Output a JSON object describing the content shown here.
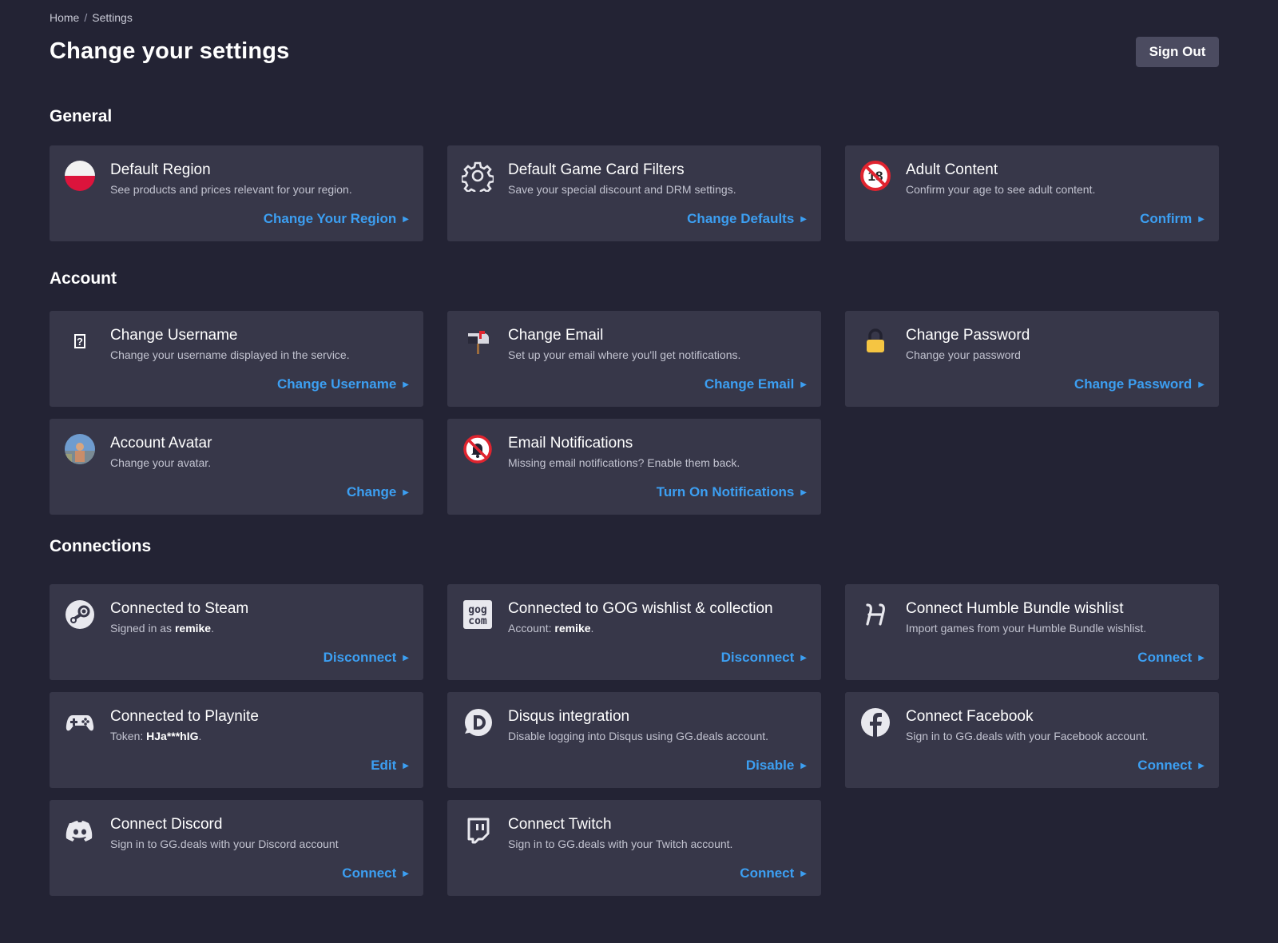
{
  "breadcrumb": {
    "home": "Home",
    "sep": "/",
    "current": "Settings"
  },
  "header": {
    "title": "Change your settings",
    "sign_out": "Sign Out"
  },
  "colors": {
    "background": "#232334",
    "card": "#373749",
    "accent": "#3c9ff2",
    "button": "#4b4b60"
  },
  "sections": {
    "general": {
      "title": "General",
      "cards": [
        {
          "icon": "poland-flag-icon",
          "title": "Default Region",
          "desc": "See products and prices relevant for your region.",
          "action": "Change Your Region"
        },
        {
          "icon": "gear-icon",
          "title": "Default Game Card Filters",
          "desc": "Save your special discount and DRM settings.",
          "action": "Change Defaults"
        },
        {
          "icon": "no-under-18-icon",
          "title": "Adult Content",
          "desc": "Confirm your age to see adult content.",
          "action": "Confirm"
        }
      ]
    },
    "account": {
      "title": "Account",
      "cards": [
        {
          "icon": "question-mark-icon",
          "title": "Change Username",
          "desc": "Change your username displayed in the service.",
          "action": "Change Username"
        },
        {
          "icon": "mailbox-icon",
          "title": "Change Email",
          "desc": "Set up your email where you'll get notifications.",
          "action": "Change Email"
        },
        {
          "icon": "padlock-icon",
          "title": "Change Password",
          "desc": "Change your password",
          "action": "Change Password"
        },
        {
          "icon": "avatar-icon",
          "title": "Account Avatar",
          "desc": "Change your avatar.",
          "action": "Change"
        },
        {
          "icon": "no-bell-icon",
          "title": "Email Notifications",
          "desc": "Missing email notifications? Enable them back.",
          "action": "Turn On Notifications"
        }
      ]
    },
    "connections": {
      "title": "Connections",
      "cards": [
        {
          "icon": "steam-icon",
          "title": "Connected to Steam",
          "desc_prefix": "Signed in as ",
          "desc_value": "remike",
          "desc_suffix": ".",
          "action": "Disconnect"
        },
        {
          "icon": "gog-icon",
          "title": "Connected to GOG wishlist & collection",
          "desc_prefix": "Account: ",
          "desc_value": "remike",
          "desc_suffix": ".",
          "action": "Disconnect"
        },
        {
          "icon": "humble-bundle-icon",
          "title": "Connect Humble Bundle wishlist",
          "desc": "Import games from your Humble Bundle wishlist.",
          "action": "Connect"
        },
        {
          "icon": "gamepad-icon",
          "title": "Connected to Playnite",
          "desc_prefix": "Token: ",
          "desc_value": "HJa***hIG",
          "desc_suffix": ".",
          "action": "Edit"
        },
        {
          "icon": "disqus-icon",
          "title": "Disqus integration",
          "desc": "Disable logging into Disqus using GG.deals account.",
          "action": "Disable"
        },
        {
          "icon": "facebook-icon",
          "title": "Connect Facebook",
          "desc": "Sign in to GG.deals with your Facebook account.",
          "action": "Connect"
        },
        {
          "icon": "discord-icon",
          "title": "Connect Discord",
          "desc": "Sign in to GG.deals with your Discord account",
          "action": "Connect"
        },
        {
          "icon": "twitch-icon",
          "title": "Connect Twitch",
          "desc": "Sign in to GG.deals with your Twitch account.",
          "action": "Connect"
        }
      ]
    }
  }
}
